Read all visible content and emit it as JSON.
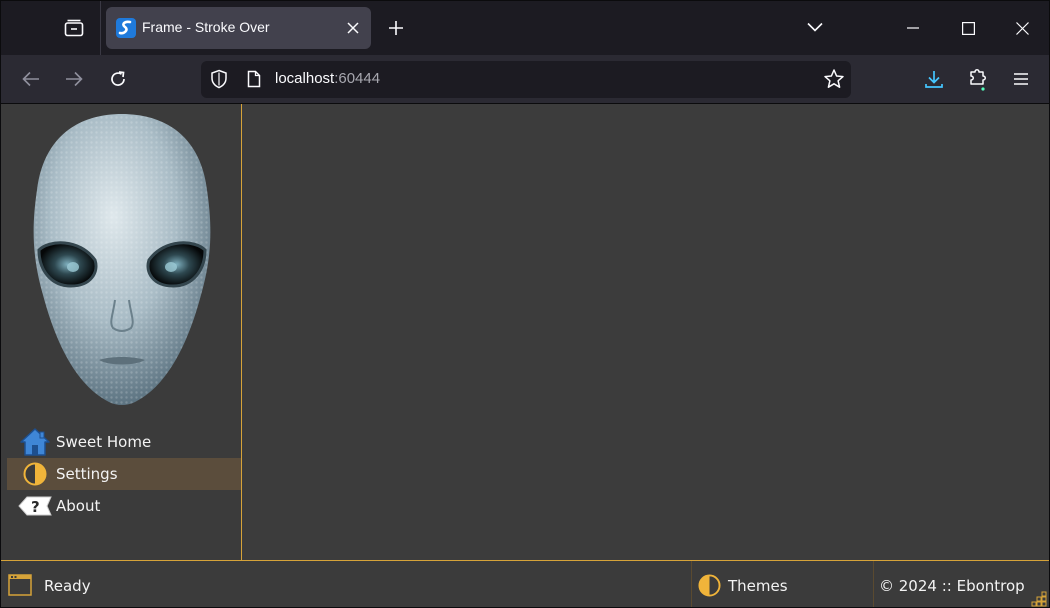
{
  "browser": {
    "tab_title": "Frame - Stroke Over",
    "url_host": "localhost",
    "url_port": ":60444"
  },
  "sidebar": {
    "items": [
      {
        "label": "Sweet Home",
        "icon": "home-icon"
      },
      {
        "label": "Settings",
        "icon": "contrast-icon",
        "selected": true
      },
      {
        "label": "About",
        "icon": "help-icon"
      }
    ]
  },
  "statusbar": {
    "status": "Ready",
    "theme_label": "Themes",
    "copyright": "© 2024 :: Ebontrop"
  },
  "colors": {
    "accent": "#d6a339",
    "selected_bg": "#5b4d3c",
    "content_bg": "#3c3c3c",
    "download_icon": "#45c6ff"
  }
}
